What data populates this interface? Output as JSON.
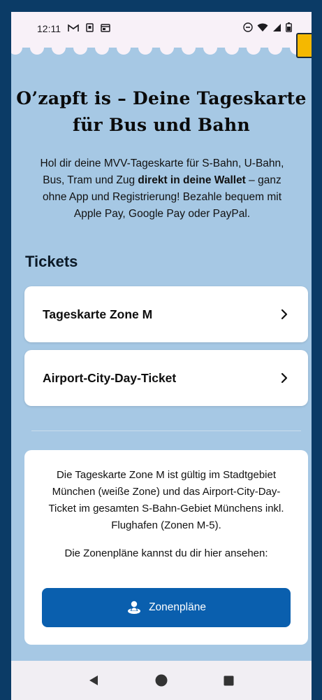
{
  "status_bar": {
    "time": "12:11",
    "icons_left": [
      "gmail-icon",
      "sim-icon",
      "screen-icon"
    ],
    "icons_right": [
      "dnd-icon",
      "wifi-icon",
      "signal-icon",
      "battery-icon"
    ]
  },
  "hero": {
    "title_line1": "O’zapft is – Deine Tageskarte",
    "title_line2": "für Bus und Bahn",
    "intro_part1": "Hol dir deine MVV-Tageskarte für S-Bahn, U-Bahn, Bus, Tram und Zug ",
    "intro_bold": "direkt in deine Wallet",
    "intro_part2": " – ganz ohne App und Registrierung! Bezahle bequem mit Apple Pay, Google Pay oder PayPal."
  },
  "tickets": {
    "heading": "Tickets",
    "items": [
      {
        "label": "Tageskarte Zone M",
        "icon": "chevron-right-icon"
      },
      {
        "label": "Airport-City-Day-Ticket",
        "icon": "chevron-right-icon"
      }
    ]
  },
  "info": {
    "text": "Die Tageskarte Zone M ist gültig im Stadtgebiet München (weiße Zone) und das Airport-City-Day-Ticket im gesamten S-Bahn-Gebiet Münchens inkl. Flughafen (Zonen M-5).",
    "zone_prompt": "Die Zonenpläne kannst du dir hier ansehen:",
    "button_label": "Zonenpläne",
    "button_icon": "map-pin-person-icon"
  },
  "colors": {
    "background": "#a6c8e4",
    "frame": "#0b3b66",
    "button": "#0a5fae",
    "accent_tab": "#f5b800"
  },
  "nav_bar": {
    "buttons": [
      "back-icon",
      "home-icon",
      "recents-icon"
    ]
  }
}
